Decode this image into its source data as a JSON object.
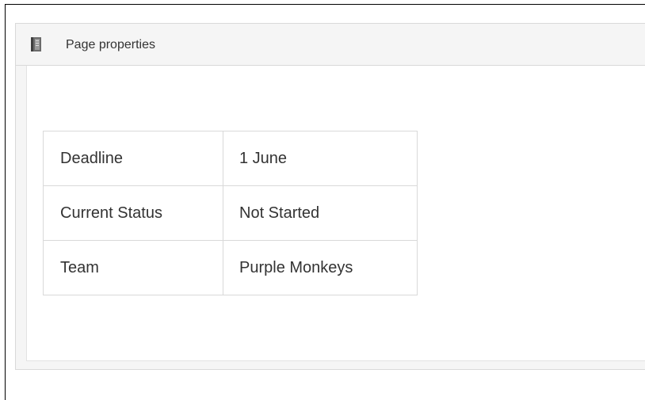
{
  "panel": {
    "title": "Page properties",
    "icon": "book-icon"
  },
  "properties": [
    {
      "key": "Deadline",
      "value": "1 June"
    },
    {
      "key": "Current Status",
      "value": "Not Started"
    },
    {
      "key": "Team",
      "value": "Purple Monkeys"
    }
  ]
}
